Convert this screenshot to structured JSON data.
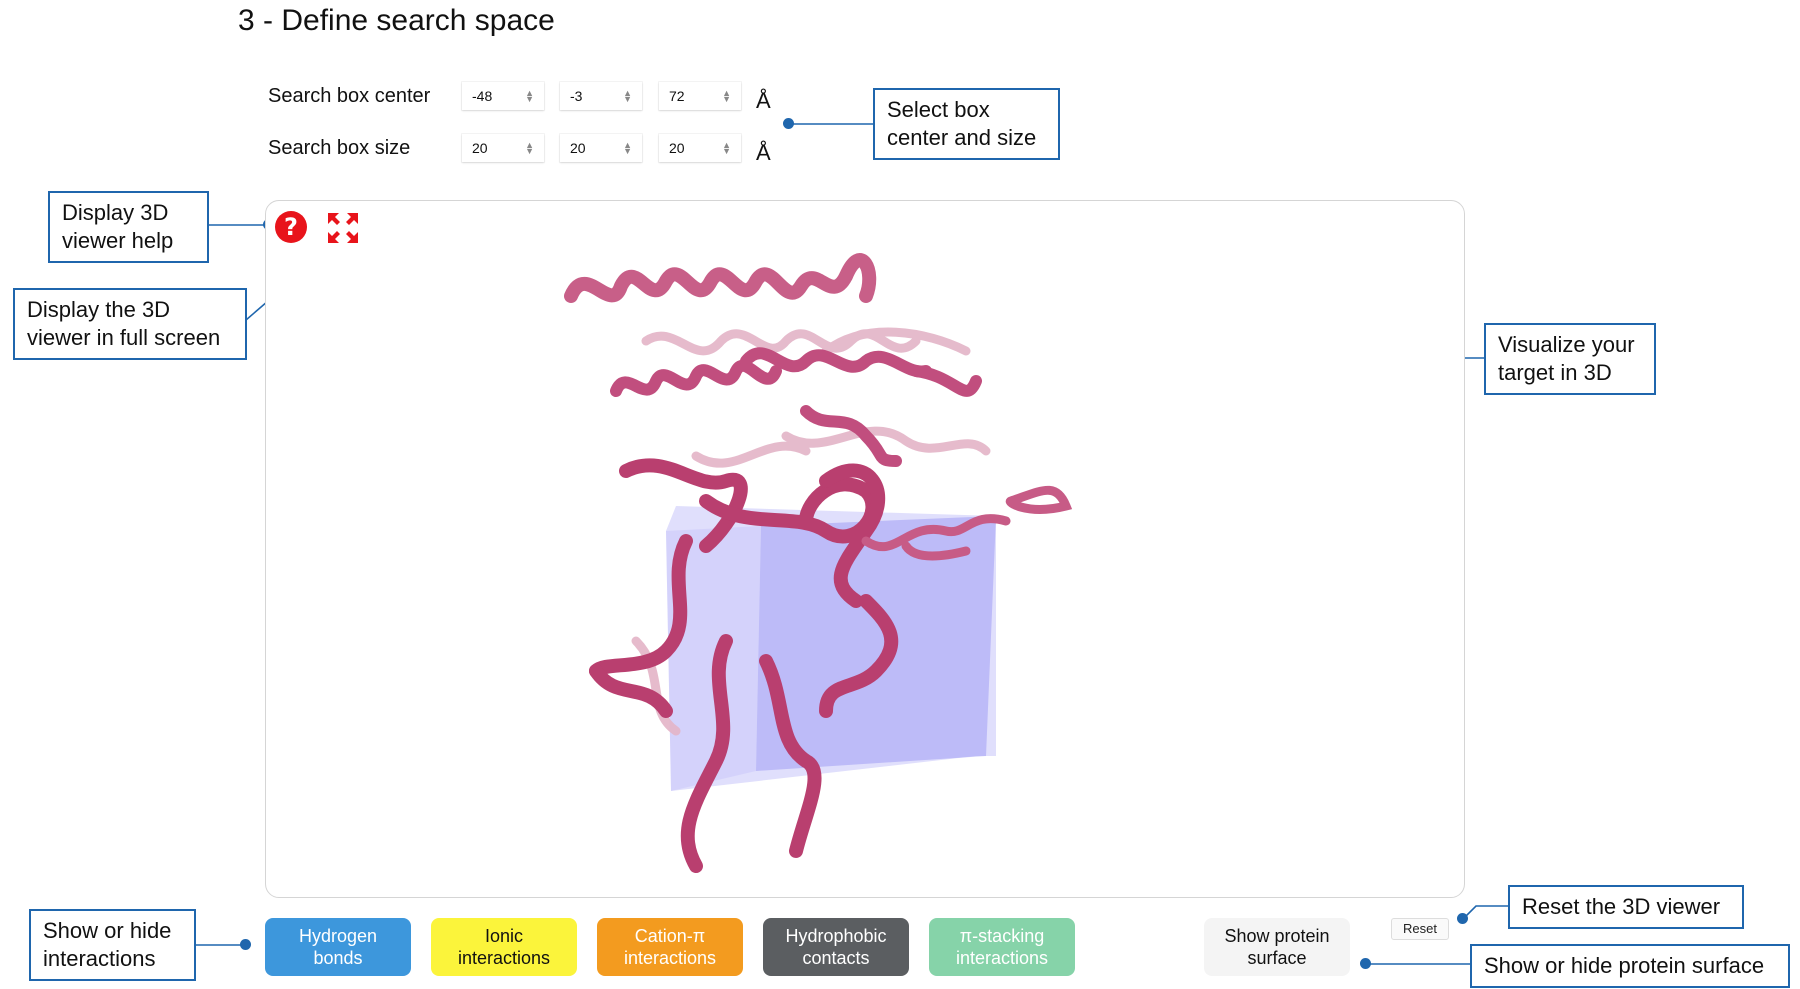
{
  "title": "3 - Define search space",
  "search_box": {
    "center_label": "Search box center",
    "size_label": "Search box size",
    "center": [
      "-48",
      "-3",
      "72"
    ],
    "size": [
      "20",
      "20",
      "20"
    ],
    "unit": "Å"
  },
  "callouts": {
    "select_box": [
      "Select box",
      "center and size"
    ],
    "viewer_help": [
      "Display 3D",
      "viewer help"
    ],
    "full_screen": [
      "Display the 3D",
      "viewer in full screen"
    ],
    "visualize": [
      "Visualize your",
      "target in 3D"
    ],
    "interactions": [
      "Show or hide",
      "interactions"
    ],
    "reset": [
      "Reset the 3D viewer"
    ],
    "surface": [
      "Show or hide protein surface"
    ]
  },
  "viewer": {
    "help_icon_glyph": "?",
    "help_icon": "help-circle-icon",
    "fullscreen_icon": "expand-arrows-icon",
    "accent": "#e8141b"
  },
  "interaction_buttons": [
    {
      "lines": [
        "Hydrogen",
        "bonds"
      ],
      "bg": "#3d97dc",
      "fg": "#ffffff"
    },
    {
      "lines": [
        "Ionic",
        "interactions"
      ],
      "bg": "#fbf43b",
      "fg": "#111111"
    },
    {
      "lines": [
        "Cation-π",
        "interactions"
      ],
      "bg": "#f39b1f",
      "fg": "#ffffff"
    },
    {
      "lines": [
        "Hydrophobic",
        "contacts"
      ],
      "bg": "#5b5e61",
      "fg": "#ffffff"
    },
    {
      "lines": [
        "π-stacking",
        "interactions"
      ],
      "bg": "#86d3a9",
      "fg": "#ffffff"
    }
  ],
  "surface_button": {
    "lines": [
      "Show protein",
      "surface"
    ],
    "bg": "#f4f4f4",
    "fg": "#111111"
  },
  "reset_button": "Reset",
  "colors": {
    "callout_border": "#1f66ad",
    "protein": "#c24a79",
    "search_box": "#8f8cf5"
  }
}
